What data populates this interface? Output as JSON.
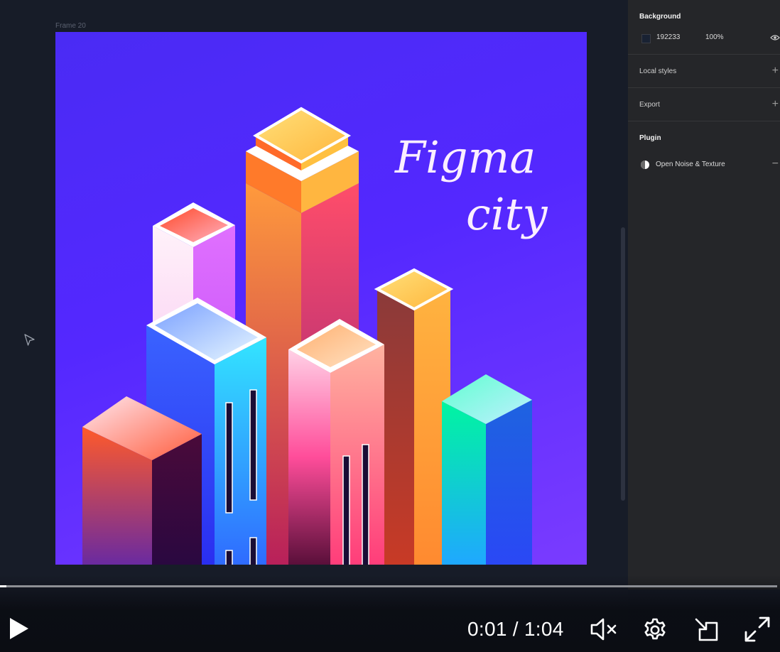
{
  "canvas": {
    "frame_label": "Frame 20",
    "artwork": {
      "title_line1": "Figma",
      "title_line2": "city"
    }
  },
  "panel": {
    "background": {
      "title": "Background",
      "hex": "192233",
      "opacity": "100%",
      "swatch_color": "#192233"
    },
    "local_styles": {
      "title": "Local styles"
    },
    "export": {
      "title": "Export"
    },
    "plugin": {
      "title": "Plugin",
      "item": "Open Noise & Texture"
    }
  },
  "player": {
    "time": "0:01 / 1:04",
    "progress": 0.008,
    "icons": [
      "play-icon",
      "mute-icon",
      "settings-icon",
      "airplay-icon",
      "fullscreen-icon"
    ]
  }
}
